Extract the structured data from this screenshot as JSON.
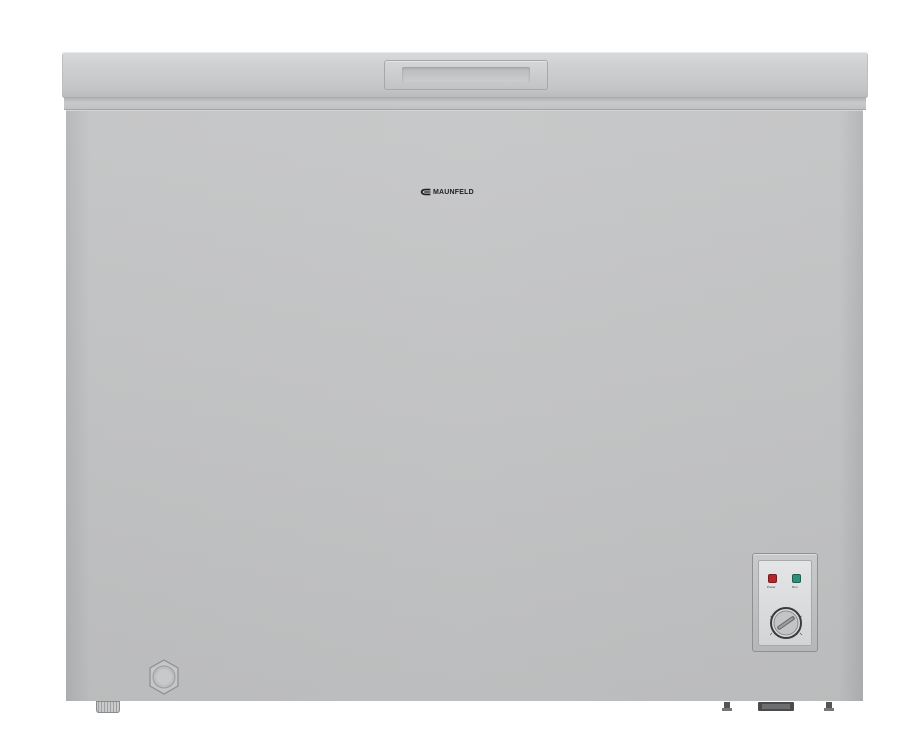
{
  "scene": {
    "subject": "chest-freezer",
    "colors": {
      "body": "#c4c5c6",
      "lid": "#cfd0d1",
      "background": "#ffffff",
      "led_power": "#b5262a",
      "led_run": "#2f8f7d",
      "brand_text": "#1f1f22"
    }
  },
  "brand": {
    "name": "MAUNFELD",
    "logo_icon": "maunfeld-logo-icon"
  },
  "control_panel": {
    "led_power_label": "Power",
    "led_run_label": "Run",
    "knob_icon": "thermostat-knob-icon"
  }
}
